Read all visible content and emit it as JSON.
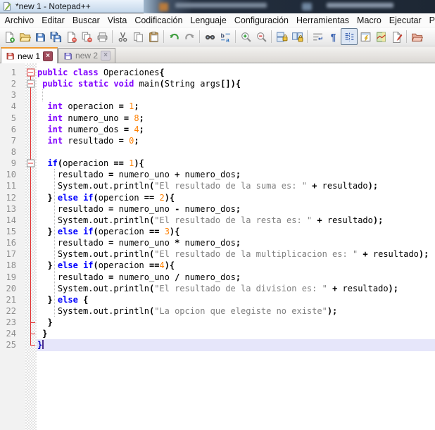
{
  "window": {
    "title": "*new 1 - Notepad++"
  },
  "menu": {
    "items": [
      "Archivo",
      "Editar",
      "Buscar",
      "Vista",
      "Codificación",
      "Lenguaje",
      "Configuración",
      "Herramientas",
      "Macro",
      "Ejecutar",
      "Plugins"
    ]
  },
  "toolbar": {
    "buttons": [
      {
        "icon": "new-file"
      },
      {
        "icon": "open-file"
      },
      {
        "icon": "save"
      },
      {
        "icon": "save-all"
      },
      {
        "icon": "close"
      },
      {
        "icon": "close-all"
      },
      {
        "icon": "print"
      },
      {
        "sep": true
      },
      {
        "icon": "cut"
      },
      {
        "icon": "copy"
      },
      {
        "icon": "paste"
      },
      {
        "sep": true
      },
      {
        "icon": "undo"
      },
      {
        "icon": "redo"
      },
      {
        "sep": true
      },
      {
        "icon": "find"
      },
      {
        "icon": "replace"
      },
      {
        "sep": true
      },
      {
        "icon": "zoom-in"
      },
      {
        "icon": "zoom-out"
      },
      {
        "sep": true
      },
      {
        "icon": "sync-vertical-scroll"
      },
      {
        "icon": "sync-horizontal-scroll"
      },
      {
        "sep": true
      },
      {
        "icon": "word-wrap"
      },
      {
        "icon": "show-all-characters"
      },
      {
        "icon": "show-indent-guide",
        "pressed": true
      },
      {
        "icon": "function-list"
      },
      {
        "icon": "document-map"
      },
      {
        "icon": "macro-record"
      },
      {
        "sep": true
      },
      {
        "icon": "folder-as-workspace"
      }
    ]
  },
  "tabs": [
    {
      "label": "new 1",
      "active": true,
      "modified": true
    },
    {
      "label": "new 2",
      "active": false,
      "modified": false
    }
  ],
  "colors": {
    "keyword_type": "#8000FF",
    "keyword_instruction": "#0000FF",
    "number": "#FF8000",
    "string": "#808080",
    "current_line_bg": "#E6E6FA",
    "fold_tree": "#E03030",
    "tab_active_stripe": "#F09B30"
  },
  "editor": {
    "language": "Java",
    "caret_line": 25,
    "lines": [
      {
        "n": 1,
        "fold": "box1",
        "tokens": [
          [
            "k",
            "public"
          ],
          [
            "d",
            " "
          ],
          [
            "k",
            "class"
          ],
          [
            "d",
            " Operaciones"
          ],
          [
            "o",
            "{"
          ]
        ]
      },
      {
        "n": 2,
        "fold": "box",
        "tokens": [
          [
            "d",
            " "
          ],
          [
            "k",
            "public"
          ],
          [
            "d",
            " "
          ],
          [
            "k",
            "static"
          ],
          [
            "d",
            " "
          ],
          [
            "k",
            "void"
          ],
          [
            "d",
            " main"
          ],
          [
            "o",
            "("
          ],
          [
            "d",
            "String args"
          ],
          [
            "o",
            "[]){"
          ]
        ]
      },
      {
        "n": 3,
        "fold": "v",
        "tokens": []
      },
      {
        "n": 4,
        "fold": "v",
        "tokens": [
          [
            "d",
            "  "
          ],
          [
            "k",
            "int"
          ],
          [
            "d",
            " operacion "
          ],
          [
            "o",
            "="
          ],
          [
            "d",
            " "
          ],
          [
            "n",
            "1"
          ],
          [
            "o",
            ";"
          ]
        ]
      },
      {
        "n": 5,
        "fold": "v",
        "tokens": [
          [
            "d",
            "  "
          ],
          [
            "k",
            "int"
          ],
          [
            "d",
            " numero_uno "
          ],
          [
            "o",
            "="
          ],
          [
            "d",
            " "
          ],
          [
            "n",
            "8"
          ],
          [
            "o",
            ";"
          ]
        ]
      },
      {
        "n": 6,
        "fold": "v",
        "tokens": [
          [
            "d",
            "  "
          ],
          [
            "k",
            "int"
          ],
          [
            "d",
            " numero_dos "
          ],
          [
            "o",
            "="
          ],
          [
            "d",
            " "
          ],
          [
            "n",
            "4"
          ],
          [
            "o",
            ";"
          ]
        ]
      },
      {
        "n": 7,
        "fold": "v",
        "tokens": [
          [
            "d",
            "  "
          ],
          [
            "k",
            "int"
          ],
          [
            "d",
            " resultado "
          ],
          [
            "o",
            "="
          ],
          [
            "d",
            " "
          ],
          [
            "n",
            "0"
          ],
          [
            "o",
            ";"
          ]
        ]
      },
      {
        "n": 8,
        "fold": "v",
        "tokens": []
      },
      {
        "n": 9,
        "fold": "box",
        "tokens": [
          [
            "d",
            "  "
          ],
          [
            "i",
            "if"
          ],
          [
            "o",
            "("
          ],
          [
            "d",
            "operacion "
          ],
          [
            "o",
            "=="
          ],
          [
            "d",
            " "
          ],
          [
            "n",
            "1"
          ],
          [
            "o",
            "){"
          ]
        ]
      },
      {
        "n": 10,
        "fold": "v",
        "tokens": [
          [
            "d",
            "    resultado "
          ],
          [
            "o",
            "="
          ],
          [
            "d",
            " numero_uno "
          ],
          [
            "o",
            "+"
          ],
          [
            "d",
            " numero_dos"
          ],
          [
            "o",
            ";"
          ]
        ]
      },
      {
        "n": 11,
        "fold": "v",
        "tokens": [
          [
            "d",
            "    System.out.println"
          ],
          [
            "o",
            "("
          ],
          [
            "s",
            "\"El resultado de la suma es: \""
          ],
          [
            "d",
            " "
          ],
          [
            "o",
            "+"
          ],
          [
            "d",
            " resultado"
          ],
          [
            "o",
            ");"
          ]
        ]
      },
      {
        "n": 12,
        "fold": "v",
        "tokens": [
          [
            "d",
            "  "
          ],
          [
            "o",
            "}"
          ],
          [
            "d",
            " "
          ],
          [
            "i",
            "else"
          ],
          [
            "d",
            " "
          ],
          [
            "i",
            "if"
          ],
          [
            "o",
            "("
          ],
          [
            "d",
            "opercion "
          ],
          [
            "o",
            "=="
          ],
          [
            "d",
            " "
          ],
          [
            "n",
            "2"
          ],
          [
            "o",
            "){"
          ]
        ]
      },
      {
        "n": 13,
        "fold": "v",
        "tokens": [
          [
            "d",
            "    resultado "
          ],
          [
            "o",
            "="
          ],
          [
            "d",
            " numero_uno "
          ],
          [
            "o",
            "-"
          ],
          [
            "d",
            " numero_dos"
          ],
          [
            "o",
            ";"
          ]
        ]
      },
      {
        "n": 14,
        "fold": "v",
        "tokens": [
          [
            "d",
            "    System.out.println"
          ],
          [
            "o",
            "("
          ],
          [
            "s",
            "\"El resultado de la resta es: \""
          ],
          [
            "d",
            " "
          ],
          [
            "o",
            "+"
          ],
          [
            "d",
            " resultado"
          ],
          [
            "o",
            ");"
          ]
        ]
      },
      {
        "n": 15,
        "fold": "v",
        "tokens": [
          [
            "d",
            "  "
          ],
          [
            "o",
            "}"
          ],
          [
            "d",
            " "
          ],
          [
            "i",
            "else"
          ],
          [
            "d",
            " "
          ],
          [
            "i",
            "if"
          ],
          [
            "o",
            "("
          ],
          [
            "d",
            "operacion "
          ],
          [
            "o",
            "=="
          ],
          [
            "d",
            " "
          ],
          [
            "n",
            "3"
          ],
          [
            "o",
            "){"
          ]
        ]
      },
      {
        "n": 16,
        "fold": "v",
        "tokens": [
          [
            "d",
            "    resultado "
          ],
          [
            "o",
            "="
          ],
          [
            "d",
            " numero_uno "
          ],
          [
            "o",
            "*"
          ],
          [
            "d",
            " numero_dos"
          ],
          [
            "o",
            ";"
          ]
        ]
      },
      {
        "n": 17,
        "fold": "v",
        "tokens": [
          [
            "d",
            "    System.out.println"
          ],
          [
            "o",
            "("
          ],
          [
            "s",
            "\"El resultado de la multiplicacion es: \""
          ],
          [
            "d",
            " "
          ],
          [
            "o",
            "+"
          ],
          [
            "d",
            " resultado"
          ],
          [
            "o",
            ");"
          ]
        ]
      },
      {
        "n": 18,
        "fold": "v",
        "tokens": [
          [
            "d",
            "  "
          ],
          [
            "o",
            "}"
          ],
          [
            "d",
            " "
          ],
          [
            "i",
            "else"
          ],
          [
            "d",
            " "
          ],
          [
            "i",
            "if"
          ],
          [
            "o",
            "("
          ],
          [
            "d",
            "operacion "
          ],
          [
            "o",
            "=="
          ],
          [
            "n",
            "4"
          ],
          [
            "o",
            "){"
          ]
        ]
      },
      {
        "n": 19,
        "fold": "v",
        "tokens": [
          [
            "d",
            "    resultado "
          ],
          [
            "o",
            "="
          ],
          [
            "d",
            " numero_uno "
          ],
          [
            "o",
            "/"
          ],
          [
            "d",
            " numero_dos"
          ],
          [
            "o",
            ";"
          ]
        ]
      },
      {
        "n": 20,
        "fold": "v",
        "tokens": [
          [
            "d",
            "    System.out.println"
          ],
          [
            "o",
            "("
          ],
          [
            "s",
            "\"El resultado de la division es: \""
          ],
          [
            "d",
            " "
          ],
          [
            "o",
            "+"
          ],
          [
            "d",
            " resultado"
          ],
          [
            "o",
            ");"
          ]
        ]
      },
      {
        "n": 21,
        "fold": "v",
        "tokens": [
          [
            "d",
            "  "
          ],
          [
            "o",
            "}"
          ],
          [
            "d",
            " "
          ],
          [
            "i",
            "else"
          ],
          [
            "d",
            " "
          ],
          [
            "o",
            "{"
          ]
        ]
      },
      {
        "n": 22,
        "fold": "v",
        "tokens": [
          [
            "d",
            "    System.out.println"
          ],
          [
            "o",
            "("
          ],
          [
            "s",
            "\"La opcion que elegiste no existe\""
          ],
          [
            "o",
            ");"
          ]
        ]
      },
      {
        "n": 23,
        "fold": "t",
        "tokens": [
          [
            "d",
            "  "
          ],
          [
            "o",
            "}"
          ]
        ]
      },
      {
        "n": 24,
        "fold": "t",
        "tokens": [
          [
            "d",
            " "
          ],
          [
            "o",
            "}"
          ]
        ]
      },
      {
        "n": 25,
        "fold": "e",
        "tokens": [
          [
            "b",
            "}"
          ]
        ]
      }
    ]
  }
}
